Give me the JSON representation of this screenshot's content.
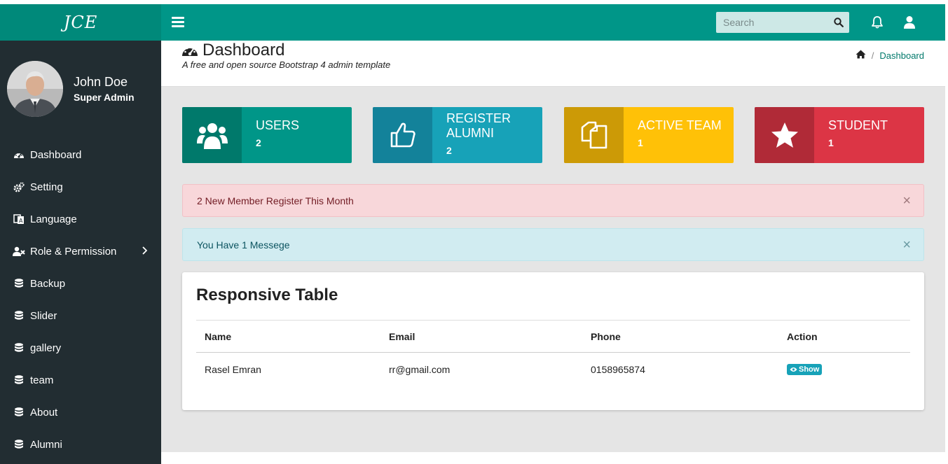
{
  "brand": {
    "logo_text": "JCE"
  },
  "topbar": {
    "search_placeholder": "Search"
  },
  "user": {
    "name": "John Doe",
    "role": "Super Admin"
  },
  "sidebar": {
    "items": [
      {
        "label": "Dashboard",
        "icon": "dashboard-icon"
      },
      {
        "label": "Setting",
        "icon": "cogs-icon"
      },
      {
        "label": "Language",
        "icon": "language-icon"
      },
      {
        "label": "Role & Permission",
        "icon": "user-times-icon",
        "has_submenu": true
      },
      {
        "label": "Backup",
        "icon": "database-icon"
      },
      {
        "label": "Slider",
        "icon": "database-icon"
      },
      {
        "label": "gallery",
        "icon": "database-icon"
      },
      {
        "label": "team",
        "icon": "database-icon"
      },
      {
        "label": "About",
        "icon": "database-icon"
      },
      {
        "label": "Alumni",
        "icon": "database-icon"
      }
    ]
  },
  "header": {
    "title": "Dashboard",
    "subtitle": "A free and open source Bootstrap 4 admin template",
    "breadcrumb": [
      "Dashboard"
    ]
  },
  "cards": [
    {
      "label": "USERS",
      "value": "2",
      "icon": "users-icon",
      "color": "#009688",
      "icon_bg": "#00796b"
    },
    {
      "label": "REGISTER ALUMNI",
      "value": "2",
      "icon": "thumbs-up-icon",
      "color": "#17a2b8",
      "icon_bg": "#13829a"
    },
    {
      "label": "ACTIVE TEAM",
      "value": "1",
      "icon": "files-icon",
      "color": "#ffc107",
      "icon_bg": "#cc9a06"
    },
    {
      "label": "STUDENT",
      "value": "1",
      "icon": "star-icon",
      "color": "#dc3545",
      "icon_bg": "#b02a37"
    }
  ],
  "alerts": [
    {
      "text": "2 New Member Register This Month",
      "type": "danger"
    },
    {
      "text": "You Have 1 Messege",
      "type": "info"
    }
  ],
  "table": {
    "title": "Responsive Table",
    "columns": [
      "Name",
      "Email",
      "Phone",
      "Action"
    ],
    "rows": [
      {
        "name": "Rasel Emran",
        "email": "rr@gmail.com",
        "phone": "0158965874",
        "action": "Show"
      }
    ]
  }
}
